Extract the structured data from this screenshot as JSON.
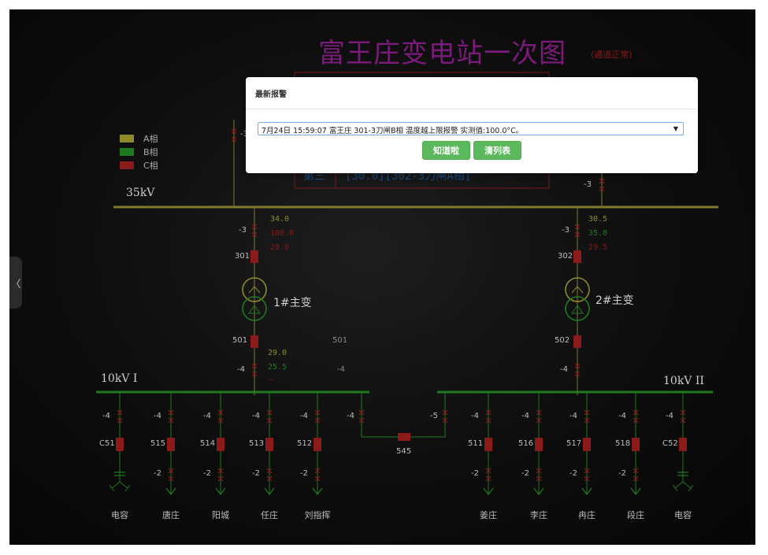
{
  "station": {
    "title": "富王庄变电站一次图",
    "status": "(通道正常)"
  },
  "legend": [
    {
      "label": "A相",
      "color": "#8b8b2a"
    },
    {
      "label": "B相",
      "color": "#1f7a1f"
    },
    {
      "label": "C相",
      "color": "#8b1a1a"
    }
  ],
  "buses": {
    "hv": "35kV",
    "lv1": "10kV I",
    "lv2": "10kV II"
  },
  "panel_text": {
    "row_label": "第三",
    "row_value": "[30.0][302-3刀闸A相]"
  },
  "transformers": [
    {
      "name": "1#主变",
      "hv_breaker": "301",
      "hv_switch": "-3",
      "lv_breaker": "501",
      "lv_switch": "-4",
      "hv_readings": [
        "34.0",
        "100.0",
        "29.0"
      ],
      "lv_readings": [
        "29.0",
        "25.5",
        "—"
      ]
    },
    {
      "name": "2#主变",
      "hv_breaker": "302",
      "hv_switch": "-3",
      "lv_breaker": "502",
      "lv_switch": "-4",
      "hv_readings": [
        "30.5",
        "35.0",
        "29.5"
      ]
    }
  ],
  "misc_labels": {
    "left_incoming_switch": "-3",
    "right_incoming_switch": "-3",
    "bus_tie_left_switch": "-4",
    "bus_tie_right_switch": "-5",
    "bus_tie_breaker": "545",
    "ghost_501": "501",
    "ghost_minus4": "-4"
  },
  "feeders": [
    {
      "breaker": "C51",
      "top": "-4",
      "bottom": "",
      "name": "电容"
    },
    {
      "breaker": "515",
      "top": "-4",
      "bottom": "-2",
      "name": "唐庄"
    },
    {
      "breaker": "514",
      "top": "-4",
      "bottom": "-2",
      "name": "阳城"
    },
    {
      "breaker": "513",
      "top": "-4",
      "bottom": "-2",
      "name": "任庄"
    },
    {
      "breaker": "512",
      "top": "-4",
      "bottom": "-2",
      "name": "刘指挥"
    },
    {
      "breaker": "511",
      "top": "-4",
      "bottom": "-2",
      "name": "姜庄"
    },
    {
      "breaker": "516",
      "top": "-4",
      "bottom": "-2",
      "name": "李庄"
    },
    {
      "breaker": "517",
      "top": "-4",
      "bottom": "-2",
      "name": "冉庄"
    },
    {
      "breaker": "518",
      "top": "-4",
      "bottom": "-2",
      "name": "段庄"
    },
    {
      "breaker": "C52",
      "top": "-4",
      "bottom": "",
      "name": "电容"
    }
  ],
  "modal": {
    "title": "最新报警",
    "alarm_text": "7月24日 15:59:07 富王庄 301-3刀闸B相 温度越上限报警 实测值:100.0°C。",
    "ack_button": "知道啦",
    "clear_button": "清列表"
  },
  "colors": {
    "phase_a": "#8b8b2a",
    "phase_b": "#1f7a1f",
    "phase_c": "#8b1a1a",
    "bus_hv": "#7f7a2e",
    "bus_lv": "#1f7a1f"
  }
}
